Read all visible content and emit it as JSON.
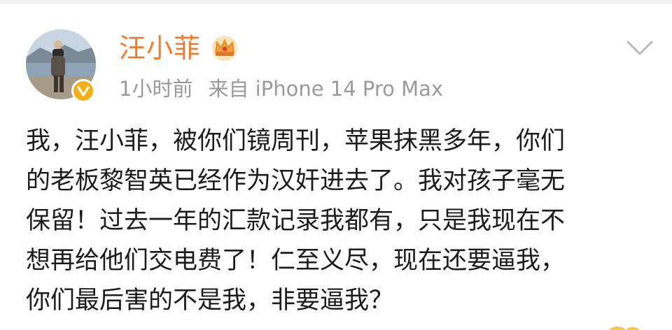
{
  "post": {
    "author": {
      "name": "汪小菲",
      "avatar_icon": "avatar-photo",
      "verified_icon": "verified-v-icon",
      "verified_color": "#f5b018",
      "member_icon": "crown-icon",
      "name_color": "#f07c2c"
    },
    "meta": {
      "time": "1小时前",
      "source": "来自 iPhone 14 Pro Max"
    },
    "menu_icon": "chevron-down-icon",
    "content_lines": [
      "我，汪小菲，被你们镜周刊，苹果抹黑多年，你们",
      "的老板黎智英已经作为汉奸进去了。我对孩子毫无",
      "保留！过去一年的汇款记录我都有，只是我现在不",
      "想再给他们交电费了！仁至义尽，现在还要逼我，",
      "你们最后害的不是我，非要逼我？"
    ]
  }
}
